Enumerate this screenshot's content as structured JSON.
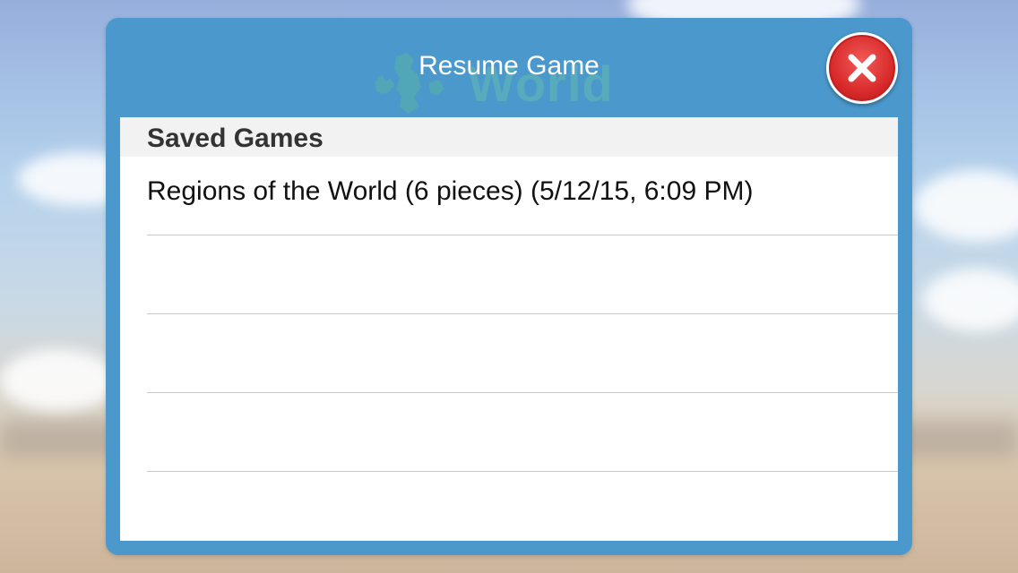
{
  "dialog": {
    "title": "Resume Game",
    "watermark_text": "World",
    "close_icon": "close-x-icon"
  },
  "saved_games": {
    "header": "Saved Games",
    "items": [
      {
        "label": "Regions of the World (6 pieces) (5/12/15, 6:09 PM)"
      },
      {
        "label": ""
      },
      {
        "label": ""
      },
      {
        "label": ""
      }
    ]
  },
  "colors": {
    "dialog_blue": "#4a98cc",
    "close_red": "#d82a2a",
    "header_gray": "#f2f2f2"
  }
}
